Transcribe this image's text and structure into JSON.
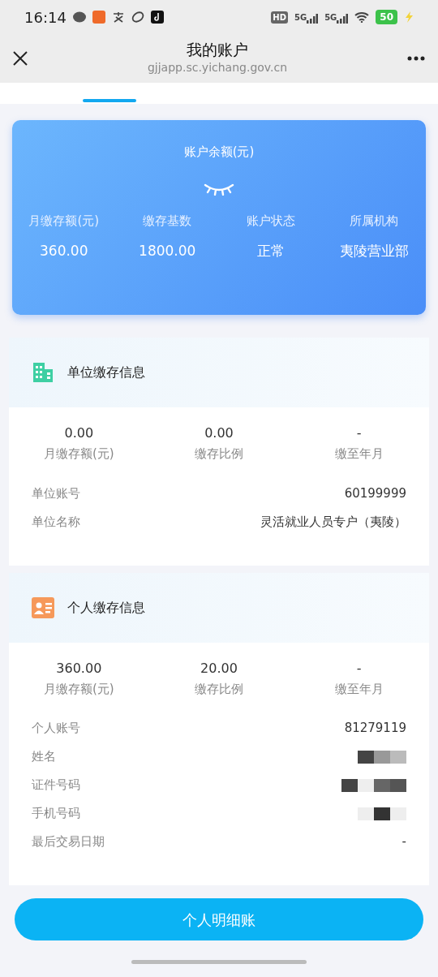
{
  "status_bar": {
    "time": "16:14",
    "network_labels": [
      "HD",
      "5G",
      "5G"
    ],
    "battery": "50"
  },
  "header": {
    "title": "我的账户",
    "url": "gjjapp.sc.yichang.gov.cn"
  },
  "balance_card": {
    "title": "账户余额(元)",
    "balance_hidden": true,
    "stats": [
      {
        "label": "月缴存额(元)",
        "value": "360.00"
      },
      {
        "label": "缴存基数",
        "value": "1800.00"
      },
      {
        "label": "账户状态",
        "value": "正常"
      },
      {
        "label": "所属机构",
        "value": "夷陵营业部"
      }
    ]
  },
  "sections": [
    {
      "kind": "company",
      "title": "单位缴存信息",
      "stats": [
        {
          "value": "0.00",
          "label": "月缴存额(元)"
        },
        {
          "value": "0.00",
          "label": "缴存比例"
        },
        {
          "value": "-",
          "label": "缴至年月"
        }
      ],
      "rows": [
        {
          "label": "单位账号",
          "value": "60199999",
          "redacted": false
        },
        {
          "label": "单位名称",
          "value": "灵活就业人员专户（夷陵）",
          "redacted": false
        }
      ]
    },
    {
      "kind": "personal",
      "title": "个人缴存信息",
      "stats": [
        {
          "value": "360.00",
          "label": "月缴存额(元)"
        },
        {
          "value": "20.00",
          "label": "缴存比例"
        },
        {
          "value": "-",
          "label": "缴至年月"
        }
      ],
      "rows": [
        {
          "label": "个人账号",
          "value": "81279119",
          "redacted": false
        },
        {
          "label": "姓名",
          "redacted": true
        },
        {
          "label": "证件号码",
          "redacted": true
        },
        {
          "label": "手机号码",
          "redacted": true
        },
        {
          "label": "最后交易日期",
          "value": "-",
          "redacted": false
        }
      ]
    }
  ],
  "button": {
    "label": "个人明细账"
  }
}
